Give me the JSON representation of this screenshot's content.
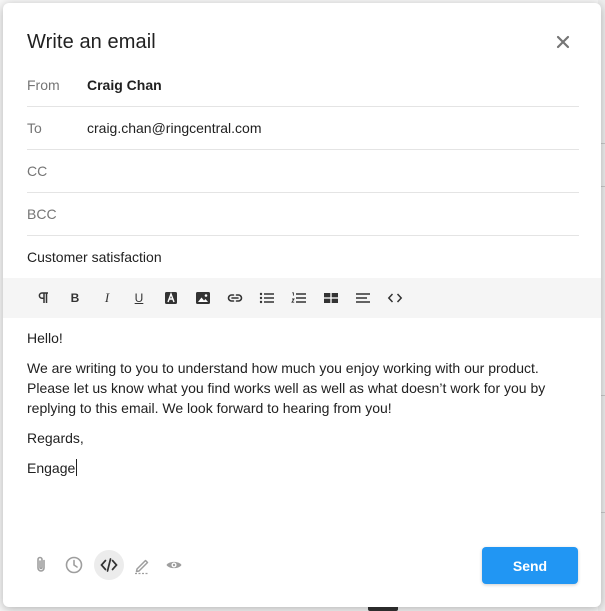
{
  "dialog": {
    "title": "Write an email",
    "close_icon": "close-icon"
  },
  "fields": {
    "from": {
      "label": "From",
      "value": "Craig Chan"
    },
    "to": {
      "label": "To",
      "value": "craig.chan@ringcentral.com"
    },
    "cc": {
      "label": "CC",
      "value": ""
    },
    "bcc": {
      "label": "BCC",
      "value": ""
    },
    "subject": {
      "value": "Customer satisfaction"
    }
  },
  "toolbar": {
    "items": [
      "paragraph-icon",
      "bold-icon",
      "italic-icon",
      "underline-icon",
      "text-color-icon",
      "insert-image-icon",
      "insert-link-icon",
      "bulleted-list-icon",
      "numbered-list-icon",
      "table-icon",
      "align-icon",
      "source-code-icon"
    ],
    "bold_glyph": "B",
    "italic_glyph": "I",
    "underline_glyph": "U"
  },
  "body": {
    "greeting": "Hello!",
    "paragraph": "We are writing to you to understand how much you enjoy working with our product. Please let us know what you find works well as well as what doesn’t work for you by replying to this email.  We look forward to hearing from you!",
    "closing": "Regards,",
    "signature": "Engage"
  },
  "footer": {
    "icons": [
      "attachment-icon",
      "schedule-clock-icon",
      "code-view-icon",
      "signature-icon",
      "preview-eye-icon"
    ],
    "send_label": "Send"
  },
  "colors": {
    "send_button": "#2196f3",
    "toolbar_bg": "#f5f5f5",
    "label_gray": "#757575",
    "divider": "#e4e4e4"
  }
}
